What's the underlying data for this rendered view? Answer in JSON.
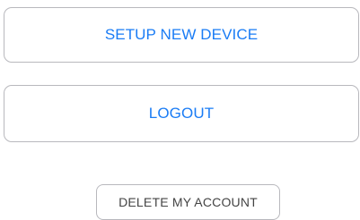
{
  "buttons": {
    "setup_label": "SETUP NEW DEVICE",
    "logout_label": "LOGOUT",
    "delete_label": "DELETE MY ACCOUNT"
  },
  "colors": {
    "accent": "#1a7cf5",
    "border": "#b8b8bd",
    "secondary_text": "#444444",
    "background": "#ffffff"
  }
}
